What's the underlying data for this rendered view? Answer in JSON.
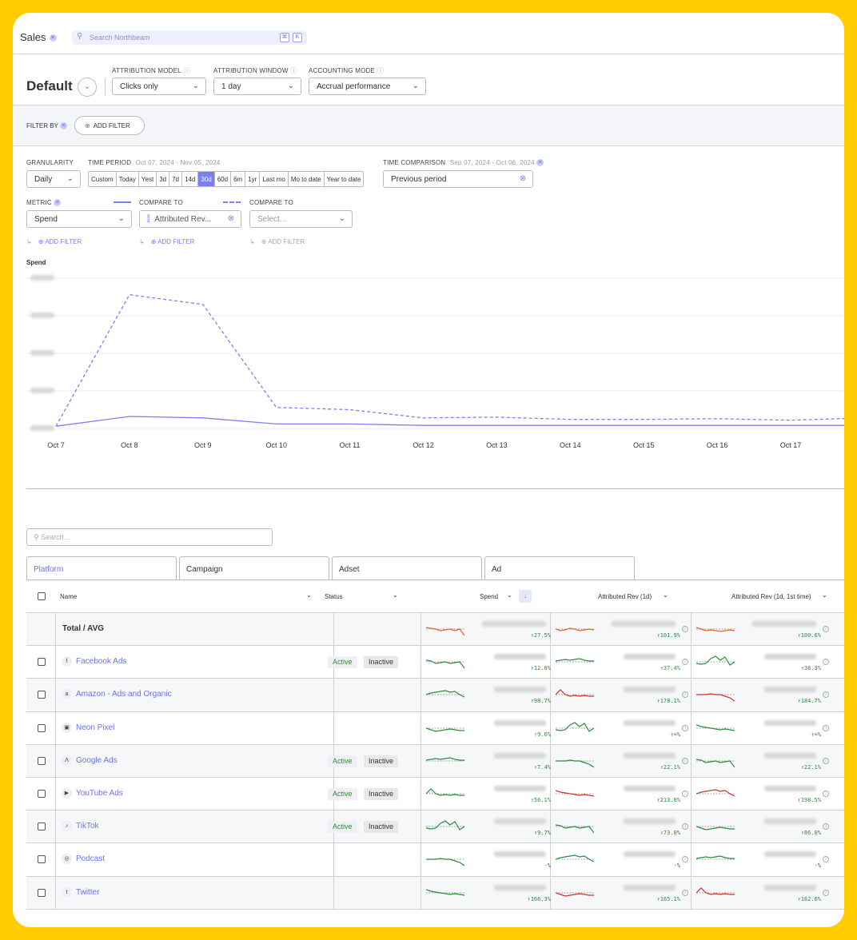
{
  "app": {
    "title": "Sales",
    "search_placeholder": "Search Northbeam",
    "kbd": [
      "⌘",
      "K"
    ]
  },
  "view": {
    "name": "Default"
  },
  "settings": {
    "attribution_model": {
      "label": "ATTRIBUTION MODEL",
      "value": "Clicks only"
    },
    "attribution_window": {
      "label": "ATTRIBUTION WINDOW",
      "value": "1 day"
    },
    "accounting_mode": {
      "label": "ACCOUNTING MODE",
      "value": "Accrual performance"
    }
  },
  "filter": {
    "label": "FILTER BY",
    "add_label": "ADD FILTER"
  },
  "granularity": {
    "label": "GRANULARITY",
    "value": "Daily"
  },
  "time_period": {
    "label": "TIME PERIOD",
    "range": "Oct 07, 2024 - Nov 05, 2024",
    "options": [
      "Custom",
      "Today",
      "Yest",
      "3d",
      "7d",
      "14d",
      "30d",
      "60d",
      "6m",
      "1yr",
      "Last mo",
      "Mo to date",
      "Year to date"
    ],
    "selected": "30d"
  },
  "time_comparison": {
    "label": "TIME COMPARISON",
    "range": "Sep 07, 2024 - Oct 06, 2024",
    "value": "Previous period"
  },
  "metric": {
    "label": "METRIC",
    "value": "Spend"
  },
  "compare_to_1": {
    "label": "COMPARE TO",
    "value": "Attributed Rev..."
  },
  "compare_to_2": {
    "label": "COMPARE TO",
    "placeholder": "Select..."
  },
  "sub_filters": [
    "ADD FILTER",
    "ADD FILTER",
    "ADD FILTER"
  ],
  "chart_data": {
    "type": "line",
    "title": "Spend",
    "x": [
      "Oct 7",
      "Oct 8",
      "Oct 9",
      "Oct 10",
      "Oct 11",
      "Oct 12",
      "Oct 13",
      "Oct 14",
      "Oct 15",
      "Oct 16",
      "Oct 17"
    ],
    "series": [
      {
        "style": "solid",
        "values": [
          0.3,
          1.6,
          1.4,
          0.6,
          0.6,
          0.4,
          0.4,
          0.4,
          0.4,
          0.4,
          0.4,
          0.4
        ]
      },
      {
        "style": "dashed",
        "values": [
          0.3,
          17.8,
          16.5,
          2.8,
          2.5,
          1.4,
          1.5,
          1.2,
          1.2,
          1.3,
          1.1,
          1.4
        ]
      }
    ],
    "ylim": [
      0,
      20
    ],
    "grid": true,
    "y_ticks_blurred": true,
    "colors": {
      "solid": "#7b80f0",
      "dashed": "#7b80f0"
    }
  },
  "table": {
    "search_placeholder": "Search...",
    "tabs": [
      "Platform",
      "Campaign",
      "Adset",
      "Ad"
    ],
    "active_tab": "Platform",
    "headers": {
      "name": "Name",
      "status": "Status",
      "spend": "Spend",
      "rev1": "Attributed Rev (1d)",
      "rev2": "Attributed Rev (1d, 1st time)"
    },
    "total_label": "Total / AVG",
    "total": {
      "spend_delta": "↑27.5%",
      "rev1_delta": "↑101.9%",
      "rev2_delta": "↑100.6%"
    },
    "rows": [
      {
        "name": "Facebook Ads",
        "icon": "facebook-icon",
        "glyph": "f",
        "active": "Active",
        "inactive": "Inactive",
        "spend_delta": "↑12.0%",
        "rev1_delta": "↑37.4%",
        "rev2_delta": "↑38.3%"
      },
      {
        "name": "Amazon - Ads and Organic",
        "icon": "amazon-icon",
        "glyph": "a",
        "active": "",
        "inactive": "",
        "spend_delta": "↑98.7%",
        "rev1_delta": "↑178.1%",
        "rev2_delta": "↑184.7%"
      },
      {
        "name": "Neon Pixel",
        "icon": "neon-pixel-icon",
        "glyph": "▣",
        "active": "",
        "inactive": "",
        "spend_delta": "↑9.6%",
        "rev1_delta": "↑∞%",
        "rev2_delta": "↑∞%"
      },
      {
        "name": "Google Ads",
        "icon": "google-ads-icon",
        "glyph": "Λ",
        "active": "Active",
        "inactive": "Inactive",
        "spend_delta": "↑7.4%",
        "rev1_delta": "↑22.1%",
        "rev2_delta": "↑22.1%"
      },
      {
        "name": "YouTube Ads",
        "icon": "youtube-icon",
        "glyph": "▶",
        "active": "Active",
        "inactive": "Inactive",
        "spend_delta": "↑56.1%",
        "rev1_delta": "↑213.0%",
        "rev2_delta": "↑198.5%"
      },
      {
        "name": "TikTok",
        "icon": "tiktok-icon",
        "glyph": "♪",
        "active": "Active",
        "inactive": "Inactive",
        "spend_delta": "↑9.7%",
        "rev1_delta": "↑73.0%",
        "rev2_delta": "↑86.0%"
      },
      {
        "name": "Podcast",
        "icon": "podcast-icon",
        "glyph": "◎",
        "active": "",
        "inactive": "",
        "spend_delta": "-%",
        "rev1_delta": "-%",
        "rev2_delta": "-%"
      },
      {
        "name": "Twitter",
        "icon": "twitter-icon",
        "glyph": "t",
        "active": "",
        "inactive": "",
        "spend_delta": "↑166.3%",
        "rev1_delta": "↑165.1%",
        "rev2_delta": "↑162.6%"
      }
    ]
  }
}
